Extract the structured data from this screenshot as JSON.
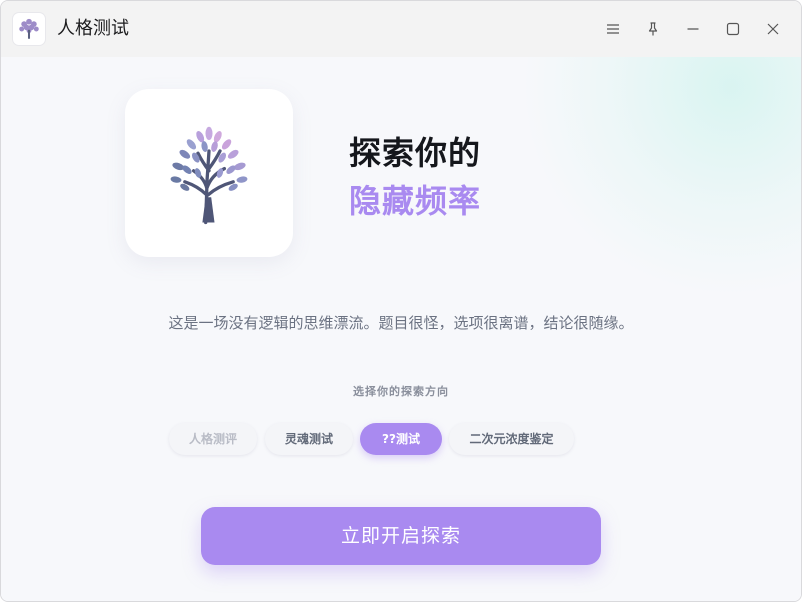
{
  "window": {
    "title": "人格测试"
  },
  "hero": {
    "line1": "探索你的",
    "line2": "隐藏频率"
  },
  "description": "这是一场没有逻辑的思维漂流。题目很怪，选项很离谱，结论很随缘。",
  "mode_selector": {
    "label": "选择你的探索方向",
    "options": [
      {
        "label": "人格测评",
        "state": "faded"
      },
      {
        "label": "灵魂测试",
        "state": "normal"
      },
      {
        "label": "??测试",
        "state": "selected"
      },
      {
        "label": "二次元浓度鉴定",
        "state": "normal"
      }
    ]
  },
  "cta": {
    "label": "立即开启探索"
  },
  "colors": {
    "accent": "#a98af0",
    "titlebar": "#f3f3f3",
    "background": "#f7f8fb",
    "heading": "#15171c"
  },
  "icons": [
    "tree-logo-icon",
    "menu-icon",
    "pin-icon",
    "minimize-icon",
    "maximize-icon",
    "close-icon"
  ]
}
